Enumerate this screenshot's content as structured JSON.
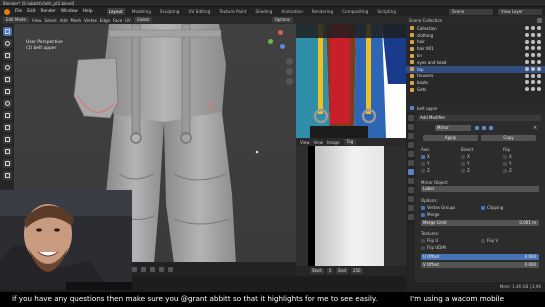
{
  "window": {
    "title": "Blender* [E:\\abbitt\\cloth_pt2.blend]"
  },
  "menu": [
    "File",
    "Edit",
    "Render",
    "Window",
    "Help"
  ],
  "workspaces": [
    "Layout",
    "Modeling",
    "Sculpting",
    "UV Editing",
    "Texture Paint",
    "Shading",
    "Animation",
    "Rendering",
    "Compositing",
    "Scripting"
  ],
  "workspace_active": "Layout",
  "scene": {
    "name": "Scene",
    "view_layer": "View Layer"
  },
  "viewport": {
    "mode": "Edit Mode",
    "orientation": "Global",
    "header_menus": [
      "View",
      "Select",
      "Add",
      "Mesh",
      "Vertex",
      "Edge",
      "Face",
      "UV"
    ],
    "options_label": "Options",
    "view_label": "User Perspective",
    "object_label": "(1) belt upper",
    "n_panel_values": [
      "0.000804 m",
      "0.000474 m",
      "0.000000 m"
    ],
    "n_panel_tab": "Editing"
  },
  "image_editor": {
    "menus": [
      "View",
      "View",
      "Image"
    ],
    "image_name": "Tag"
  },
  "timeline": {
    "start_label": "Start",
    "start": "1",
    "end_label": "End",
    "end": "250"
  },
  "outliner": {
    "title": "Scene Collection",
    "items": [
      {
        "label": "Collection"
      },
      {
        "label": "clothing"
      },
      {
        "label": "hair"
      },
      {
        "label": "hair 001"
      },
      {
        "label": "kn"
      },
      {
        "label": "eyes and head"
      },
      {
        "label": "top"
      },
      {
        "label": "trousers"
      },
      {
        "label": "boots"
      },
      {
        "label": "Gets"
      }
    ]
  },
  "properties": {
    "object_name": "belt upper",
    "section": "Add Modifier",
    "modifier_name": "Mirror",
    "apply_label": "Apply",
    "copy_label": "Copy",
    "axis_label": "Axis",
    "bisect_label": "Bisect",
    "flip_label": "Flip",
    "axes": [
      "X",
      "Y",
      "Z"
    ],
    "mirror_object_label": "Mirror Object:",
    "mirror_object_value": "Label",
    "options_label": "Options:",
    "vertex_groups_label": "Vertex Groups",
    "clipping_label": "Clipping",
    "merge_label": "Merge",
    "merge_limit_label": "Merge Limit",
    "merge_limit_value": "0.001 m",
    "textures_label": "Textures:",
    "flip_u_label": "Flip U",
    "flip_v_label": "Flip V",
    "flip_udim_label": "Flip UDIM",
    "u_offset_label": "U Offset",
    "u_offset_value": "0.000",
    "v_offset_label": "V Offset",
    "v_offset_value": "0.000"
  },
  "status": {
    "memory": "Mem: 1.46 GB | 2.90"
  },
  "subtitles": {
    "main": "if you have any questions then make sure you @grant abbitt so that it highlights for me to see easily.",
    "side": "I'm using a wacom mobile"
  },
  "colors": {
    "accent": "#4772b3",
    "selected_row": "#334d80",
    "bg": "#1d1d1d",
    "panel": "#2c2c2c"
  }
}
